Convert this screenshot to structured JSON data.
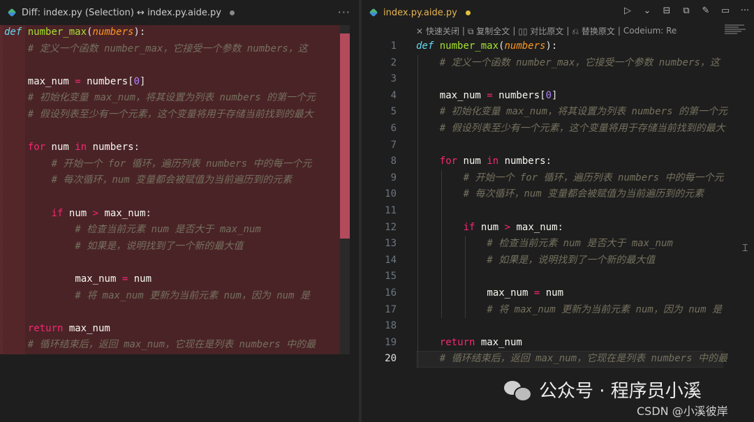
{
  "left_tab": {
    "title": "Diff: index.py (Selection) ↔ index.py.aide.py",
    "more": "···"
  },
  "right_tab": {
    "title": "index.py.aide.py"
  },
  "toolbar": {
    "items": [
      "✕ 快速关闭",
      "|",
      "⧉ 复制全文",
      "|",
      "▯▯ 对比原文",
      "|",
      "⎌ 替换原文",
      "|",
      "Codeium: Re"
    ]
  },
  "code": {
    "lines": [
      {
        "n": "1",
        "indent": 0,
        "tokens": [
          [
            "defkw",
            "def"
          ],
          [
            "sp",
            " "
          ],
          [
            "fn",
            "number_max"
          ],
          [
            "pn",
            "("
          ],
          [
            "param",
            "numbers"
          ],
          [
            "pn",
            "):"
          ]
        ]
      },
      {
        "n": "2",
        "indent": 1,
        "tokens": [
          [
            "cm",
            "# 定义一个函数 number_max，它接受一个参数 numbers，这"
          ]
        ]
      },
      {
        "n": "3",
        "indent": 1,
        "tokens": []
      },
      {
        "n": "4",
        "indent": 1,
        "tokens": [
          [
            "id",
            "max_num"
          ],
          [
            "sp",
            " "
          ],
          [
            "op",
            "="
          ],
          [
            "sp",
            " "
          ],
          [
            "id",
            "numbers"
          ],
          [
            "brk",
            "["
          ],
          [
            "num",
            "0"
          ],
          [
            "brk",
            "]"
          ]
        ]
      },
      {
        "n": "5",
        "indent": 1,
        "tokens": [
          [
            "cm",
            "# 初始化变量 max_num，将其设置为列表 numbers 的第一个元"
          ]
        ]
      },
      {
        "n": "6",
        "indent": 1,
        "tokens": [
          [
            "cm",
            "# 假设列表至少有一个元素，这个变量将用于存储当前找到的最大"
          ]
        ]
      },
      {
        "n": "7",
        "indent": 1,
        "tokens": []
      },
      {
        "n": "8",
        "indent": 1,
        "tokens": [
          [
            "kw",
            "for"
          ],
          [
            "sp",
            " "
          ],
          [
            "id",
            "num"
          ],
          [
            "sp",
            " "
          ],
          [
            "kw",
            "in"
          ],
          [
            "sp",
            " "
          ],
          [
            "id",
            "numbers"
          ],
          [
            "pn",
            ":"
          ]
        ]
      },
      {
        "n": "9",
        "indent": 2,
        "tokens": [
          [
            "cm",
            "# 开始一个 for 循环，遍历列表 numbers 中的每一个元"
          ]
        ]
      },
      {
        "n": "10",
        "indent": 2,
        "tokens": [
          [
            "cm",
            "# 每次循环，num 变量都会被赋值为当前遍历到的元素"
          ]
        ]
      },
      {
        "n": "11",
        "indent": 2,
        "tokens": []
      },
      {
        "n": "12",
        "indent": 2,
        "tokens": [
          [
            "kw",
            "if"
          ],
          [
            "sp",
            " "
          ],
          [
            "id",
            "num"
          ],
          [
            "sp",
            " "
          ],
          [
            "op",
            ">"
          ],
          [
            "sp",
            " "
          ],
          [
            "id",
            "max_num"
          ],
          [
            "pn",
            ":"
          ]
        ]
      },
      {
        "n": "13",
        "indent": 3,
        "tokens": [
          [
            "cm",
            "# 检查当前元素 num 是否大于 max_num"
          ]
        ]
      },
      {
        "n": "14",
        "indent": 3,
        "tokens": [
          [
            "cm",
            "# 如果是，说明找到了一个新的最大值"
          ]
        ]
      },
      {
        "n": "15",
        "indent": 3,
        "tokens": []
      },
      {
        "n": "16",
        "indent": 3,
        "tokens": [
          [
            "id",
            "max_num"
          ],
          [
            "sp",
            " "
          ],
          [
            "op",
            "="
          ],
          [
            "sp",
            " "
          ],
          [
            "id",
            "num"
          ]
        ]
      },
      {
        "n": "17",
        "indent": 3,
        "tokens": [
          [
            "cm",
            "# 将 max_num 更新为当前元素 num，因为 num 是"
          ]
        ]
      },
      {
        "n": "18",
        "indent": 1,
        "tokens": []
      },
      {
        "n": "19",
        "indent": 1,
        "tokens": [
          [
            "kw",
            "return"
          ],
          [
            "sp",
            " "
          ],
          [
            "id",
            "max_num"
          ]
        ]
      },
      {
        "n": "20",
        "indent": 1,
        "tokens": [
          [
            "cm",
            "# 循环结束后，返回 max_num，它现在是列表 numbers 中的最"
          ]
        ]
      }
    ],
    "active_line": "20"
  },
  "watermark": {
    "text": "公众号 · 程序员小溪"
  },
  "credit": {
    "text": "CSDN @小溪彼岸"
  },
  "colors": {
    "removed": "#4a2327",
    "keyword": "#f92672",
    "function": "#a6e22e",
    "comment": "#75715e"
  }
}
